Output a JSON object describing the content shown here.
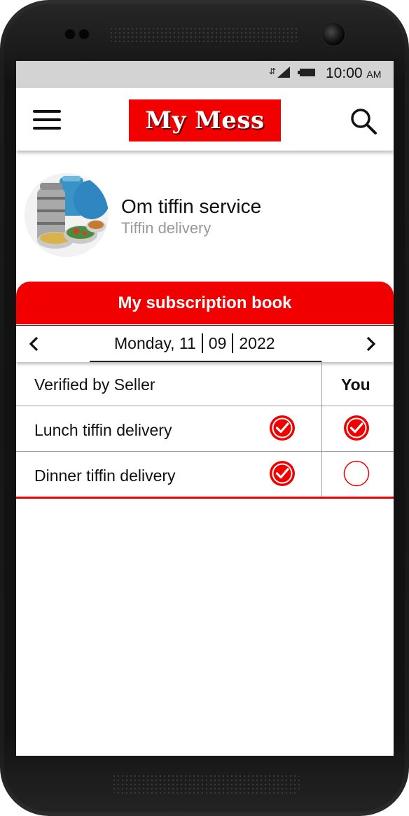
{
  "status_bar": {
    "time": "10:00",
    "ampm": "AM"
  },
  "app_bar": {
    "logo_text": "My Mess",
    "menu_icon": "hamburger-menu-icon",
    "search_icon": "search-icon"
  },
  "provider": {
    "name": "Om tiffin service",
    "subtitle": "Tiffin delivery",
    "image": "tiffin-avatar-image"
  },
  "subscription": {
    "header": "My subscription book",
    "date": {
      "day_name": "Monday,",
      "day": "11",
      "month": "09",
      "year": "2022"
    },
    "columns": {
      "seller": "Verified by Seller",
      "you": "You"
    },
    "rows": [
      {
        "label": "Lunch tiffin delivery",
        "seller_checked": true,
        "you_checked": true
      },
      {
        "label": "Dinner tiffin delivery",
        "seller_checked": true,
        "you_checked": false
      }
    ]
  },
  "colors": {
    "brand_red": "#f20000",
    "status_bar": "#d3d3d3",
    "subtitle_gray": "#999999"
  }
}
